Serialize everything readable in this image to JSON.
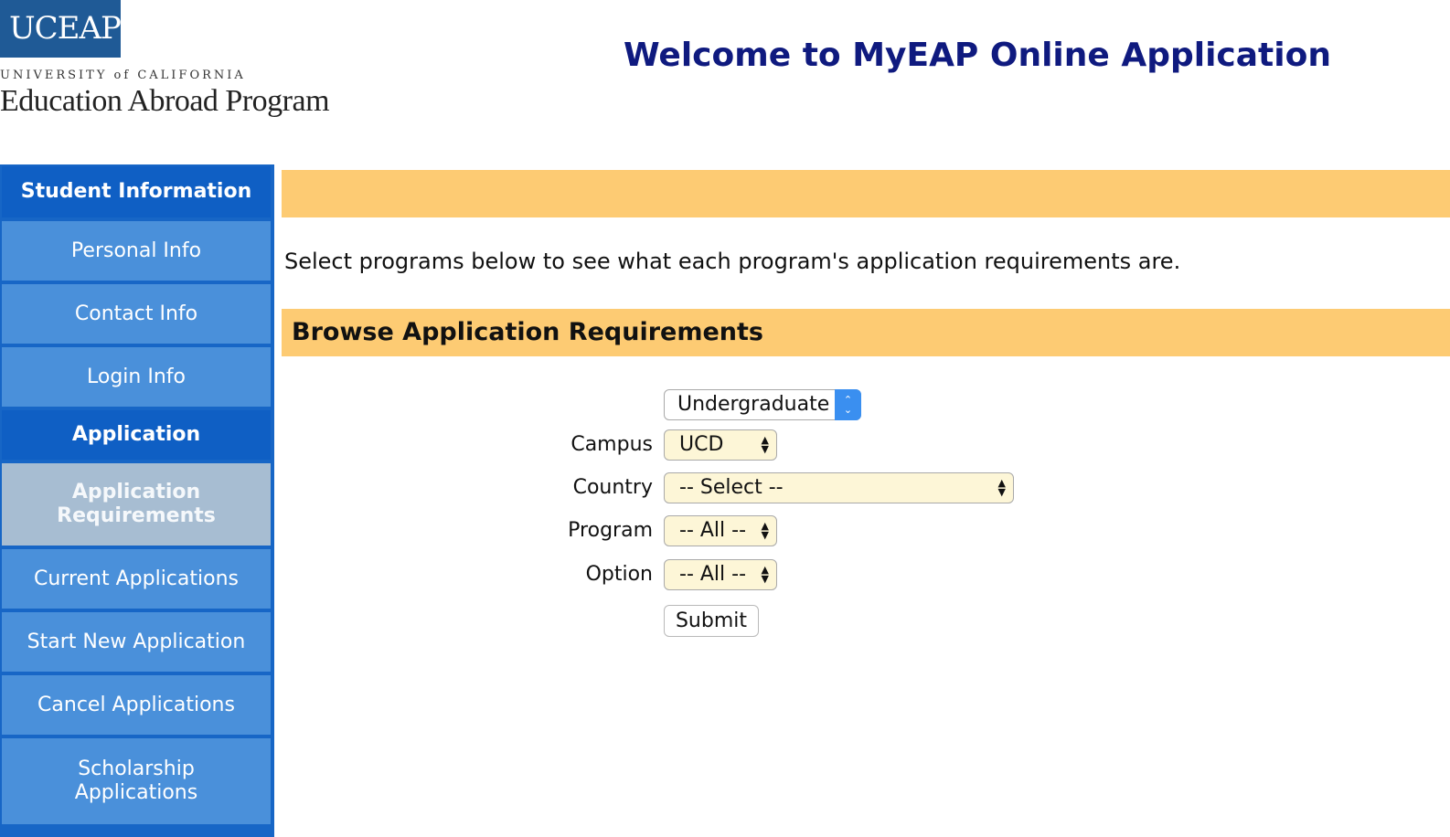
{
  "logo": {
    "mark": "UCEAP",
    "university": "UNIVERSITY of CALIFORNIA",
    "program": "Education Abroad Program"
  },
  "header": {
    "title": "Welcome to MyEAP Online Application"
  },
  "sidebar": {
    "items": [
      {
        "label": "Student Information"
      },
      {
        "label": "Personal Info"
      },
      {
        "label": "Contact Info"
      },
      {
        "label": "Login Info"
      },
      {
        "label": "Application"
      },
      {
        "label": "Application Requirements"
      },
      {
        "label": "Current Applications"
      },
      {
        "label": "Start New Application"
      },
      {
        "label": "Cancel Applications"
      },
      {
        "label": "Scholarship Applications"
      }
    ]
  },
  "main": {
    "intro": "Select programs below to see what each program's application requirements are.",
    "section_title": "Browse Application Requirements",
    "form": {
      "level": {
        "value": "Undergraduate"
      },
      "campus": {
        "label": "Campus",
        "value": "UCD"
      },
      "country": {
        "label": "Country",
        "value": "-- Select --"
      },
      "program": {
        "label": "Program",
        "value": "-- All --"
      },
      "option": {
        "label": "Option",
        "value": "-- All --"
      },
      "submit_label": "Submit"
    }
  },
  "colors": {
    "nav_blue": "#4a90da",
    "nav_section": "#0f5fc4",
    "nav_active": "#a7bdd2",
    "banner": "#fdcb73",
    "title": "#0f1a7f"
  }
}
